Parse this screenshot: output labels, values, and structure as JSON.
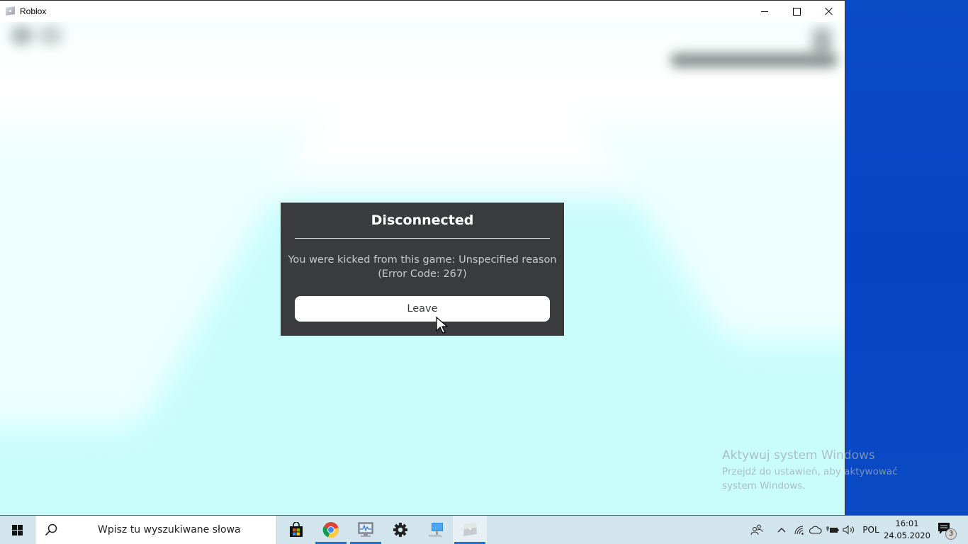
{
  "window": {
    "title": "Roblox",
    "app_icon": "roblox-icon",
    "controls": {
      "minimize": "minimize-icon",
      "maximize": "maximize-icon",
      "close": "close-icon"
    }
  },
  "dialog": {
    "title": "Disconnected",
    "message_line1": "You were kicked from this game: Unspecified reason",
    "message_line2": "(Error Code: 267)",
    "leave_button": "Leave"
  },
  "watermark": {
    "title": "Aktywuj system Windows",
    "subtitle": "Przejdź do ustawień, aby aktywować system Windows."
  },
  "taskbar": {
    "search_placeholder": "Wpisz tu wyszukiwane słowa",
    "pinned_apps": [
      {
        "name": "Microsoft Store",
        "icon": "store-icon",
        "running": false
      },
      {
        "name": "Google Chrome",
        "icon": "chrome-icon",
        "running": true
      },
      {
        "name": "Performance Monitor",
        "icon": "monitor-chart-icon",
        "running": true
      },
      {
        "name": "Settings",
        "icon": "gear-icon",
        "running": false
      },
      {
        "name": "This PC",
        "icon": "computer-icon",
        "running": false
      },
      {
        "name": "Roblox",
        "icon": "roblox-icon",
        "running": true,
        "active": true
      }
    ],
    "tray": {
      "language": "POL",
      "time": "16:01",
      "date": "24.05.2020",
      "notification_count": "3"
    }
  },
  "colors": {
    "dialog_bg": "#393b3d",
    "game_bg": "#c9fdfc",
    "desktop_bg": "#0747c0",
    "taskbar_bg": "#d2e4ec",
    "active_indicator": "#1a73d0"
  }
}
